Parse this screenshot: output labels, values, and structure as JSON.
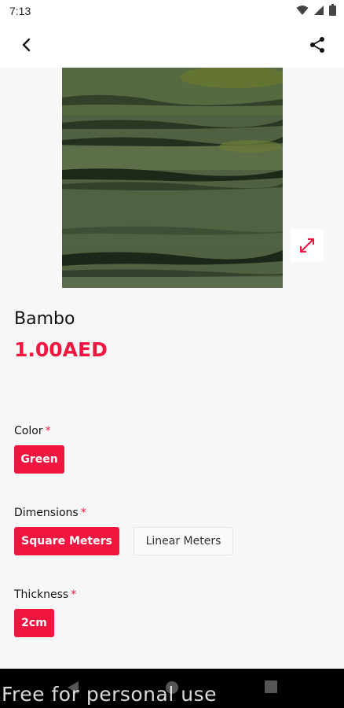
{
  "status_bar": {
    "time": "7:13",
    "icons": [
      "wifi-icon",
      "signal-icon",
      "battery-icon"
    ]
  },
  "app_bar": {
    "back_icon": "chevron-left-icon",
    "share_icon": "share-icon"
  },
  "product": {
    "image_description_icon": "marble-swatch-image",
    "expand_icon": "expand-icon",
    "name": "Bambo",
    "price": "1.00AED"
  },
  "options": {
    "color": {
      "label": "Color",
      "required_mark": "*",
      "choices": [
        "Green"
      ],
      "selected": "Green"
    },
    "dimensions": {
      "label": "Dimensions",
      "required_mark": "*",
      "choices": [
        "Square Meters",
        "Linear Meters"
      ],
      "selected": "Square Meters"
    },
    "thickness": {
      "label": "Thickness",
      "required_mark": "*",
      "choices": [
        "2cm"
      ],
      "selected": "2cm"
    }
  },
  "colors": {
    "accent": "#f0163f",
    "background": "#f7f7f7"
  },
  "watermark": "Free for personal use"
}
